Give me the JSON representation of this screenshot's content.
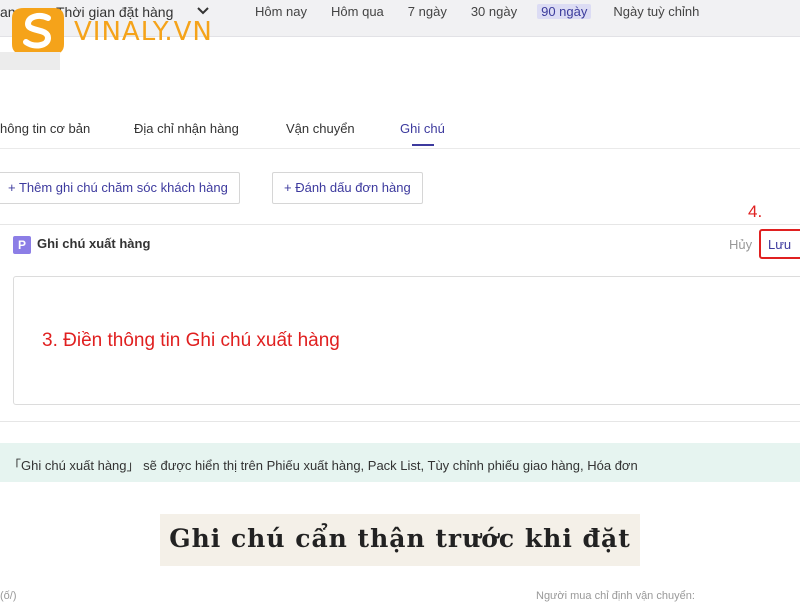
{
  "filters": {
    "leading_fragment": "an",
    "date_type_select": "Thời gian đặt hàng",
    "date_chips": [
      "Hôm nay",
      "Hôm qua",
      "7 ngày",
      "30 ngày",
      "90 ngày",
      "Ngày tuỳ chỉnh"
    ],
    "active_chip": "90 ngày"
  },
  "watermark": {
    "logo_text": "VINALY.VN",
    "color": "#f5a31a"
  },
  "tabs": [
    {
      "label": "hông tin cơ bản"
    },
    {
      "label": "Địa chỉ nhận hàng"
    },
    {
      "label": "Vận chuyển"
    },
    {
      "label": "Ghi chú"
    }
  ],
  "active_tab": "Ghi chú",
  "actions": {
    "add_care_note": "+ Thêm ghi chú chăm sóc khách hàng",
    "mark_order": "+ Đánh dấu đơn hàng"
  },
  "note_section": {
    "icon_letter": "P",
    "title": "Ghi chú xuất hàng",
    "cancel_label": "Hủy",
    "save_label": "Lưu",
    "step4_label": "4.",
    "step3_text": "3. Điền thông tin Ghi chú xuất hàng"
  },
  "info_bar": {
    "text": "「Ghi chú xuất hàng」 sẽ được hiển thị trên Phiếu xuất hàng, Pack List, Tùy chỉnh phiếu giao hàng, Hóa đơn"
  },
  "caption": "Ghi chú cẩn thận trước khi đặt",
  "bottom": {
    "left": "(ố/)",
    "right": "Người mua chỉ định vận chuyển:"
  },
  "colors": {
    "accent": "#3d3a9e",
    "annotation_red": "#e02020",
    "info_bg": "#e6f4f0",
    "p_icon": "#8c7ee6"
  }
}
